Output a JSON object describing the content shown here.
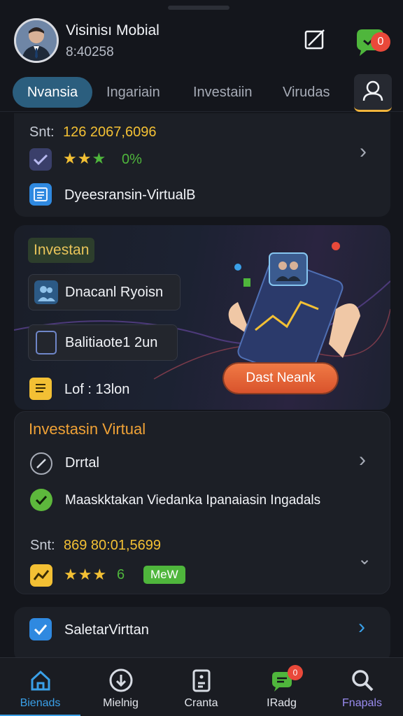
{
  "header": {
    "user_name": "Visinisı Mobial",
    "user_id": "8:40258",
    "chat_badge": "0"
  },
  "tabs": [
    {
      "label": "Nvansia",
      "active": true
    },
    {
      "label": "Ingariain"
    },
    {
      "label": "Investaiin"
    },
    {
      "label": "Virudas"
    }
  ],
  "card_top": {
    "stat_label": "Snt:",
    "stat_value": "126 2067,6096",
    "rating_percent": "0%",
    "link_text": "Dyeesransin-VirtualB"
  },
  "hero": {
    "badge": "Investan",
    "item1": "Dnacanl Ryoisn",
    "item2": "Balitiaote1 2un",
    "item3": "Lof : 13lon",
    "cta": "Dast Neank"
  },
  "virtual": {
    "title": "Investasin Virtual",
    "row1": "Drrtal",
    "row2": "Maaskktakan Viedanka Ipanaiasin Ingadals",
    "stat_label": "Snt:",
    "stat_value": "869 80:01,5699",
    "rating_suffix": "6",
    "tag": "MeW"
  },
  "card_bottom": {
    "label": "SaletarVirttan"
  },
  "nav": [
    {
      "label": "Bienads",
      "icon": "home-icon",
      "active": true
    },
    {
      "label": "Mielnig",
      "icon": "download-icon"
    },
    {
      "label": "Cranta",
      "icon": "document-icon"
    },
    {
      "label": "IRadg",
      "icon": "chat-icon",
      "badge": "0"
    },
    {
      "label": "Fnapals",
      "icon": "search-icon"
    }
  ],
  "colors": {
    "accent_gold": "#f3c034",
    "accent_orange": "#f0a236",
    "accent_blue": "#3aa0e8",
    "badge_red": "#e9493a",
    "active_tab": "#2b5e7e"
  }
}
